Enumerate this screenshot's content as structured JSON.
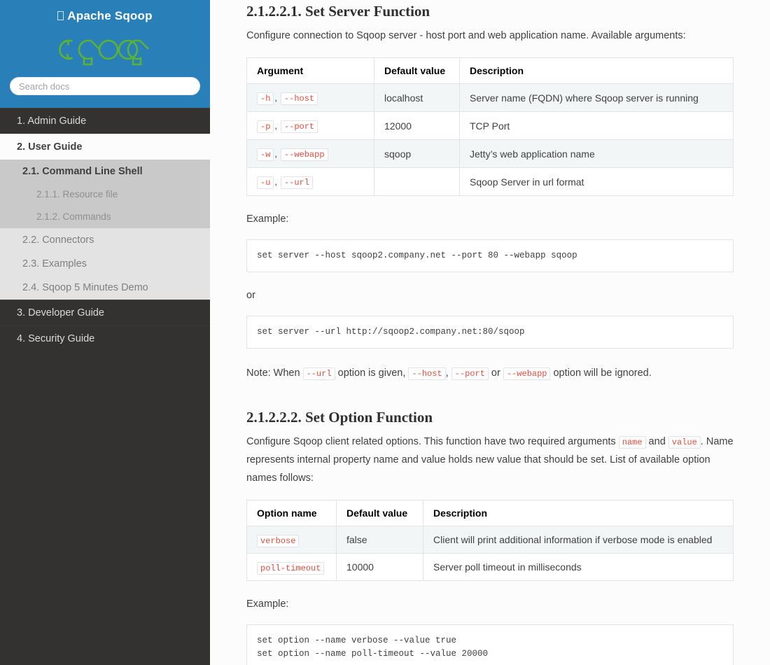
{
  "sidebar": {
    "brand_title": "Apache Sqoop",
    "brand_icon": "missing-glyph-box",
    "logo_text": "sqoop",
    "search": {
      "placeholder": "Search docs",
      "value": ""
    },
    "nav": [
      {
        "label": "1. Admin Guide",
        "level": 1,
        "current": false
      },
      {
        "label": "2. User Guide",
        "level": 1,
        "current": true
      },
      {
        "label": "2.1. Command Line Shell",
        "level": 2,
        "current": true
      },
      {
        "label": "2.1.1. Resource file",
        "level": 3,
        "current": false
      },
      {
        "label": "2.1.2. Commands",
        "level": 3,
        "current": false
      },
      {
        "label": "2.2. Connectors",
        "level": 2,
        "current": false
      },
      {
        "label": "2.3. Examples",
        "level": 2,
        "current": false
      },
      {
        "label": "2.4. Sqoop 5 Minutes Demo",
        "level": 2,
        "current": false
      },
      {
        "label": "3. Developer Guide",
        "level": 1,
        "current": false
      },
      {
        "label": "4. Security Guide",
        "level": 1,
        "current": false
      }
    ]
  },
  "content": {
    "section1": {
      "heading": "2.1.2.2.1. Set Server Function",
      "intro": "Configure connection to Sqoop server - host port and web application name. Available arguments:",
      "table": {
        "headers": [
          "Argument",
          "Default value",
          "Description"
        ],
        "rows": [
          {
            "short": "-h",
            "long": "--host",
            "default": "localhost",
            "description": "Server name (FQDN) where Sqoop server is running"
          },
          {
            "short": "-p",
            "long": "--port",
            "default": "12000",
            "description": "TCP Port"
          },
          {
            "short": "-w",
            "long": "--webapp",
            "default": "sqoop",
            "description": "Jetty’s web application name"
          },
          {
            "short": "-u",
            "long": "--url",
            "default": "",
            "description": "Sqoop Server in url format"
          }
        ]
      },
      "example_label": "Example:",
      "code1": "set server --host sqoop2.company.net --port 80 --webapp sqoop",
      "or_label": "or",
      "code2": "set server --url http://sqoop2.company.net:80/sqoop",
      "note": {
        "p1": "Note: When ",
        "code1": "--url",
        "p2": " option is given, ",
        "code2": "--host",
        "p3": ", ",
        "code3": "--port",
        "p4": " or ",
        "code4": "--webapp",
        "p5": " option will be ignored."
      }
    },
    "section2": {
      "heading": "2.1.2.2.2. Set Option Function",
      "intro": {
        "p1": "Configure Sqoop client related options. This function have two required arguments ",
        "code1": "name",
        "p2": " and ",
        "code2": "value",
        "p3": ". Name represents internal property name and value holds new value that should be set. List of available option names follows:"
      },
      "table": {
        "headers": [
          "Option name",
          "Default value",
          "Description"
        ],
        "rows": [
          {
            "name": "verbose",
            "default": "false",
            "description": "Client will print additional information if verbose mode is enabled"
          },
          {
            "name": "poll-timeout",
            "default": "10000",
            "description": "Server poll timeout in milliseconds"
          }
        ]
      },
      "example_label": "Example:",
      "code1": "set option --name verbose --value true\nset option --name poll-timeout --value 20000"
    }
  },
  "colors": {
    "sidebar_header": "#2980b9",
    "sidebar_bg": "#343131",
    "logo_green": "#5cb332",
    "code_red": "#e74c3c",
    "content_bg": "#fcfcfc",
    "table_stripe": "#f3f6f6"
  }
}
